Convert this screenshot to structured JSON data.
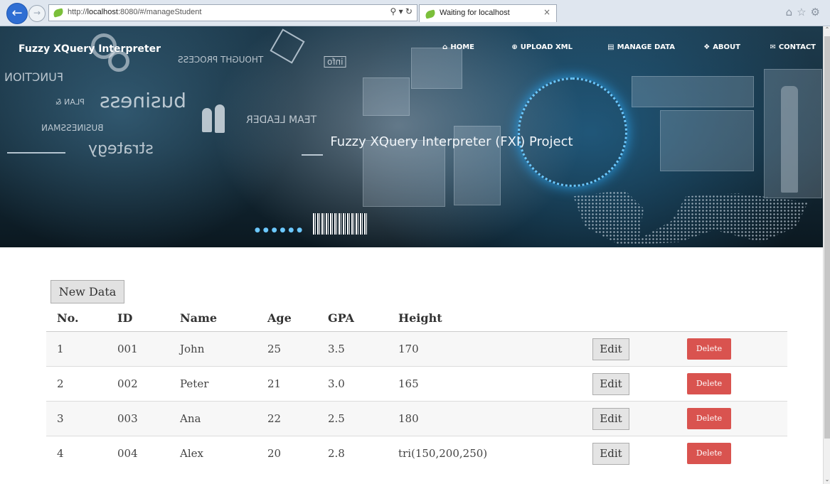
{
  "browser": {
    "url_prefix": "http://",
    "url_host": "localhost",
    "url_rest": ":8080/#/manageStudent",
    "search_icon": "search-refresh-icons",
    "tab_title": "Waiting for localhost",
    "tab_close": "×",
    "toolbar_icons": [
      "home-icon",
      "star-icon",
      "gear-icon"
    ]
  },
  "header": {
    "site_title": "Fuzzy XQuery Interpreter",
    "nav": [
      {
        "label": "HOME",
        "icon": "home-icon"
      },
      {
        "label": "UPLOAD XML",
        "icon": "upload-icon"
      },
      {
        "label": "MANAGE DATA",
        "icon": "list-icon"
      },
      {
        "label": "ABOUT",
        "icon": "info-icon"
      },
      {
        "label": "CONTACT",
        "icon": "envelope-icon"
      }
    ],
    "hero_caption": "Fuzzy XQuery Interpreter (FXI) Project",
    "hero_decor_text": {
      "function": "FUNCTION",
      "plan": "PLAN &",
      "business": "business",
      "businessman": "BUSINESSMAN",
      "strategy": "strategy",
      "thought": "THOUGHT PROCESS",
      "team": "TEAM LEADER",
      "info": "info"
    }
  },
  "toolbar": {
    "new_button": "New Data"
  },
  "table": {
    "columns": [
      "No.",
      "ID",
      "Name",
      "Age",
      "GPA",
      "Height"
    ],
    "rows": [
      {
        "no": "1",
        "id": "001",
        "name": "John",
        "age": "25",
        "gpa": "3.5",
        "height": "170"
      },
      {
        "no": "2",
        "id": "002",
        "name": "Peter",
        "age": "21",
        "gpa": "3.0",
        "height": "165"
      },
      {
        "no": "3",
        "id": "003",
        "name": "Ana",
        "age": "22",
        "gpa": "2.5",
        "height": "180"
      },
      {
        "no": "4",
        "id": "004",
        "name": "Alex",
        "age": "20",
        "gpa": "2.8",
        "height": "tri(150,200,250)"
      }
    ],
    "edit_label": "Edit",
    "delete_label": "Delete"
  },
  "colors": {
    "delete_button": "#d9534f",
    "edit_button": "#e4e4e4",
    "browser_back": "#2f6ed3"
  }
}
